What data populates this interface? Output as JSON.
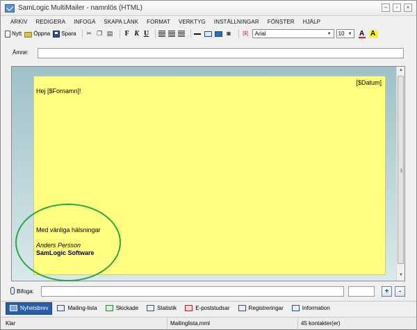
{
  "window": {
    "title": "SamLogic MultiMailer - namnlös  (HTML)"
  },
  "menubar": [
    "ARKIV",
    "REDIGERA",
    "INFOGA",
    "SKAPA LÄNK",
    "FORMAT",
    "VERKTYG",
    "INSTÄLLNINGAR",
    "FÖNSTER",
    "HJÄLP"
  ],
  "toolbar": {
    "new_label": "Nytt",
    "open_label": "Öppna",
    "save_label": "Spara",
    "bold": "F",
    "italic": "K",
    "underline": "U",
    "font": "Arial",
    "size": "10",
    "font_color_label": "A",
    "highlight_label": "A"
  },
  "subject": {
    "label": "Ämne:",
    "value": ""
  },
  "letter": {
    "date_field": "[$Datum]",
    "greeting": "Hej [$Fornamn]!",
    "closing": "Med vänliga hälsningar",
    "sender_name": "Anders Persson",
    "company": "SamLogic Software",
    "background_color": "#ffff80"
  },
  "attachment": {
    "label": "Bifoga:",
    "plus": "+",
    "minus": "-"
  },
  "tabs": [
    {
      "label": "Nyhetsbrev",
      "active": true
    },
    {
      "label": "Mailing-lista",
      "active": false
    },
    {
      "label": "Skickade",
      "active": false
    },
    {
      "label": "Statistik",
      "active": false
    },
    {
      "label": "E-poststudsar",
      "active": false
    },
    {
      "label": "Registreringar",
      "active": false
    },
    {
      "label": "Information",
      "active": false
    }
  ],
  "status": {
    "state": "Klar",
    "file": "Mailinglista.mml",
    "contacts": "45 kontakter(er)"
  },
  "colors": {
    "accent": "#2b5ea8",
    "highlight_circle": "#28a745"
  }
}
